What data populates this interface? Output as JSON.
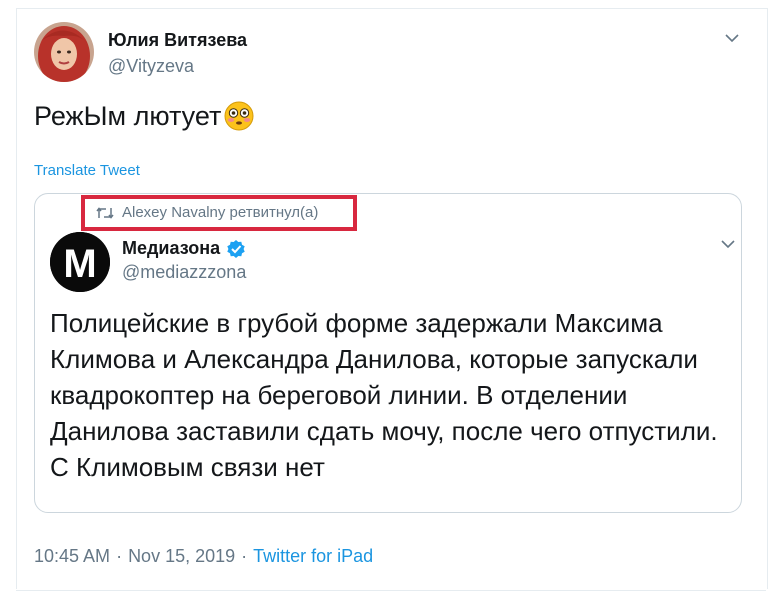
{
  "tweet": {
    "author_name": "Юлия Витязева",
    "author_handle": "@Vityzeva",
    "text": "РежЫм лютует",
    "emoji": "flushed-face",
    "translate_label": "Translate Tweet",
    "timestamp_time": "10:45 AM",
    "separator": "·",
    "timestamp_date": "Nov 15, 2019",
    "source": "Twitter for iPad"
  },
  "quote": {
    "retweet_context": "Alexey Navalny ретвитнул(а)",
    "author_name": "Медиазона",
    "author_handle": "@mediazzzona",
    "verified": true,
    "avatar_letter": "M",
    "text": "Полицейские в грубой форме задержали Максима Климова и Александра Данилова, которые запускали квадрокоптер на береговой линии. В отделении Данилова заставили сдать мочу, после чего отпустили. С Климовым связи нет"
  },
  "icons": {
    "caret": "chevron-down-icon",
    "retweet": "retweet-icon",
    "verified": "verified-badge-icon"
  },
  "colors": {
    "link": "#1b95e0",
    "secondary_text": "#657786",
    "highlight": "#d8283f",
    "verified": "#1da1f2"
  }
}
